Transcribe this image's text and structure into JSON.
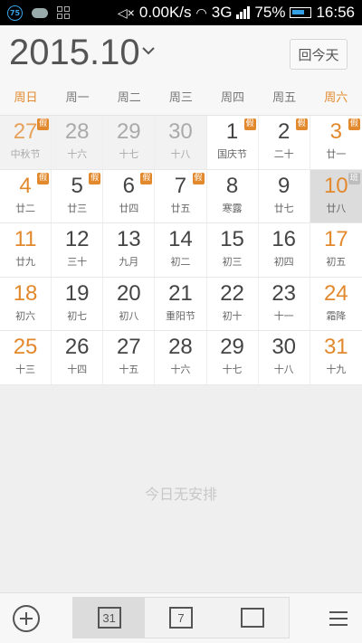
{
  "status_bar": {
    "badge_text": "75",
    "speed": "0.00K/s",
    "network": "3G",
    "battery": "75%",
    "time": "16:56"
  },
  "header": {
    "month": "2015.10",
    "today_label": "回今天"
  },
  "weekdays": [
    "周日",
    "周一",
    "周二",
    "周三",
    "周四",
    "周五",
    "周六"
  ],
  "calendar": [
    [
      {
        "day": "27",
        "lunar": "中秋节",
        "prev": true,
        "badge": "假"
      },
      {
        "day": "28",
        "lunar": "十六",
        "prev": true
      },
      {
        "day": "29",
        "lunar": "十七",
        "prev": true
      },
      {
        "day": "30",
        "lunar": "十八",
        "prev": true
      },
      {
        "day": "1",
        "lunar": "国庆节",
        "badge": "假"
      },
      {
        "day": "2",
        "lunar": "二十",
        "badge": "假"
      },
      {
        "day": "3",
        "lunar": "廿一",
        "badge": "假"
      }
    ],
    [
      {
        "day": "4",
        "lunar": "廿二",
        "badge": "假"
      },
      {
        "day": "5",
        "lunar": "廿三",
        "badge": "假"
      },
      {
        "day": "6",
        "lunar": "廿四",
        "badge": "假"
      },
      {
        "day": "7",
        "lunar": "廿五",
        "badge": "假"
      },
      {
        "day": "8",
        "lunar": "寒露"
      },
      {
        "day": "9",
        "lunar": "廿七"
      },
      {
        "day": "10",
        "lunar": "廿八",
        "badge": "班",
        "selected": true
      }
    ],
    [
      {
        "day": "11",
        "lunar": "廿九"
      },
      {
        "day": "12",
        "lunar": "三十"
      },
      {
        "day": "13",
        "lunar": "九月"
      },
      {
        "day": "14",
        "lunar": "初二"
      },
      {
        "day": "15",
        "lunar": "初三"
      },
      {
        "day": "16",
        "lunar": "初四"
      },
      {
        "day": "17",
        "lunar": "初五"
      }
    ],
    [
      {
        "day": "18",
        "lunar": "初六"
      },
      {
        "day": "19",
        "lunar": "初七"
      },
      {
        "day": "20",
        "lunar": "初八"
      },
      {
        "day": "21",
        "lunar": "重阳节"
      },
      {
        "day": "22",
        "lunar": "初十"
      },
      {
        "day": "23",
        "lunar": "十一"
      },
      {
        "day": "24",
        "lunar": "霜降"
      }
    ],
    [
      {
        "day": "25",
        "lunar": "十三"
      },
      {
        "day": "26",
        "lunar": "十四"
      },
      {
        "day": "27",
        "lunar": "十五"
      },
      {
        "day": "28",
        "lunar": "十六"
      },
      {
        "day": "29",
        "lunar": "十七"
      },
      {
        "day": "30",
        "lunar": "十八"
      },
      {
        "day": "31",
        "lunar": "十九"
      }
    ]
  ],
  "events": {
    "empty_text": "今日无安排"
  },
  "bottom_bar": {
    "month_view_label": "31",
    "week_view_label": "7"
  },
  "colors": {
    "accent": "#e3892d",
    "selected_bg": "#dcdcdc"
  }
}
